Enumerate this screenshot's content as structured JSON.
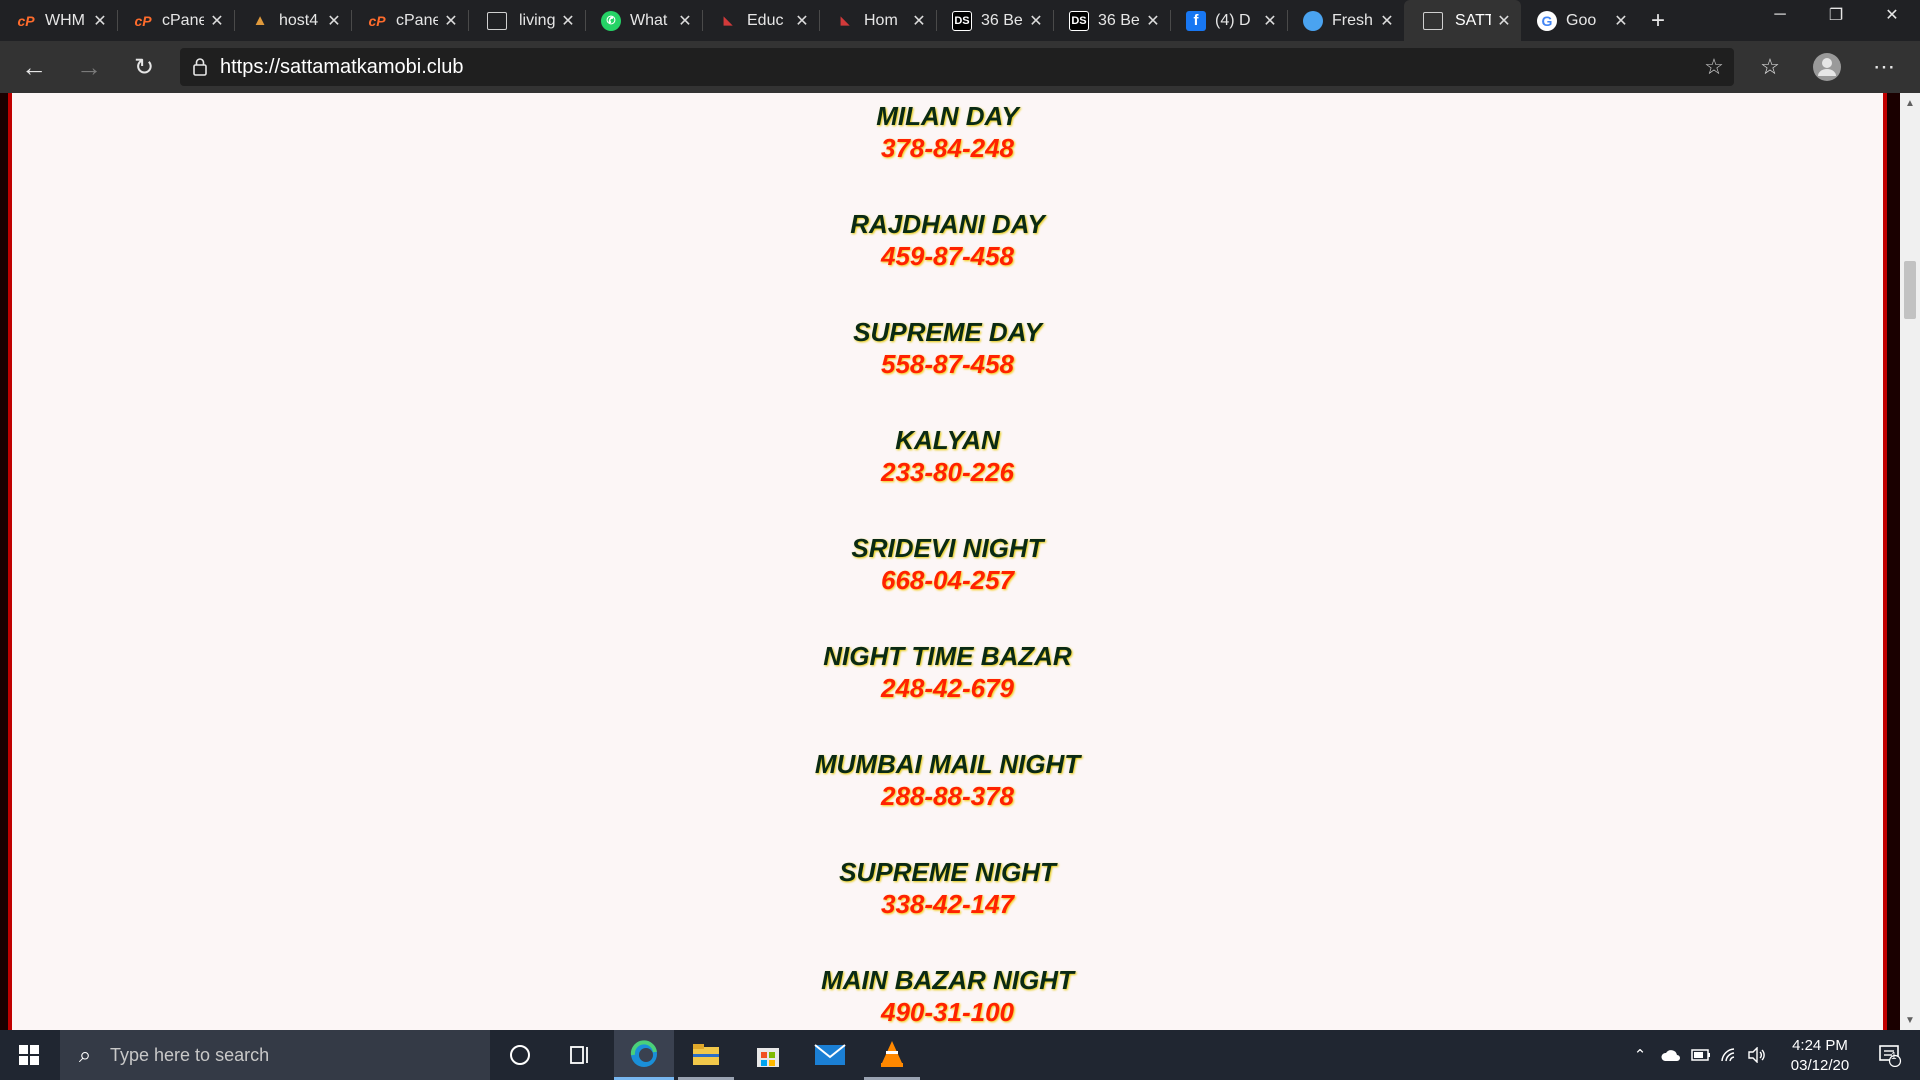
{
  "browser": {
    "tabs": [
      {
        "title": "WHM",
        "icon": "cpanel-icon"
      },
      {
        "title": "cPanel",
        "icon": "cpanel-icon"
      },
      {
        "title": "host4",
        "icon": "host-icon"
      },
      {
        "title": "cPanel",
        "icon": "cpanel-icon"
      },
      {
        "title": "living",
        "icon": "document-icon"
      },
      {
        "title": "What",
        "icon": "whatsapp-icon"
      },
      {
        "title": "Educ",
        "icon": "edu-icon"
      },
      {
        "title": "Hom",
        "icon": "edu-icon"
      },
      {
        "title": "36 Be",
        "icon": "ds-icon"
      },
      {
        "title": "36 Be",
        "icon": "ds-icon"
      },
      {
        "title": "(4) D",
        "icon": "facebook-icon"
      },
      {
        "title": "Fresh",
        "icon": "fresh-icon"
      },
      {
        "title": "SATT",
        "icon": "document-icon"
      },
      {
        "title": "Goo",
        "icon": "google-icon"
      }
    ],
    "active_tab_index": 12,
    "url": "https://sattamatkamobi.club"
  },
  "page": {
    "markets": [
      {
        "name": "MILAN DAY",
        "result": "378-84-248"
      },
      {
        "name": "RAJDHANI DAY",
        "result": "459-87-458"
      },
      {
        "name": "SUPREME DAY",
        "result": "558-87-458"
      },
      {
        "name": "KALYAN",
        "result": "233-80-226"
      },
      {
        "name": "SRIDEVI NIGHT",
        "result": "668-04-257"
      },
      {
        "name": "NIGHT TIME BAZAR",
        "result": "248-42-679"
      },
      {
        "name": "MUMBAI MAIL NIGHT",
        "result": "288-88-378"
      },
      {
        "name": "SUPREME NIGHT",
        "result": "338-42-147"
      },
      {
        "name": "MAIN BAZAR NIGHT",
        "result": "490-31-100"
      }
    ]
  },
  "taskbar": {
    "search_placeholder": "Type here to search",
    "time": "4:24 PM",
    "date": "03/12/20",
    "notification_count": "1"
  },
  "colors": {
    "market_name": "#0a2a14",
    "market_result": "#ff2200",
    "page_border": "#c00000",
    "page_background": "#fcf6f6"
  }
}
